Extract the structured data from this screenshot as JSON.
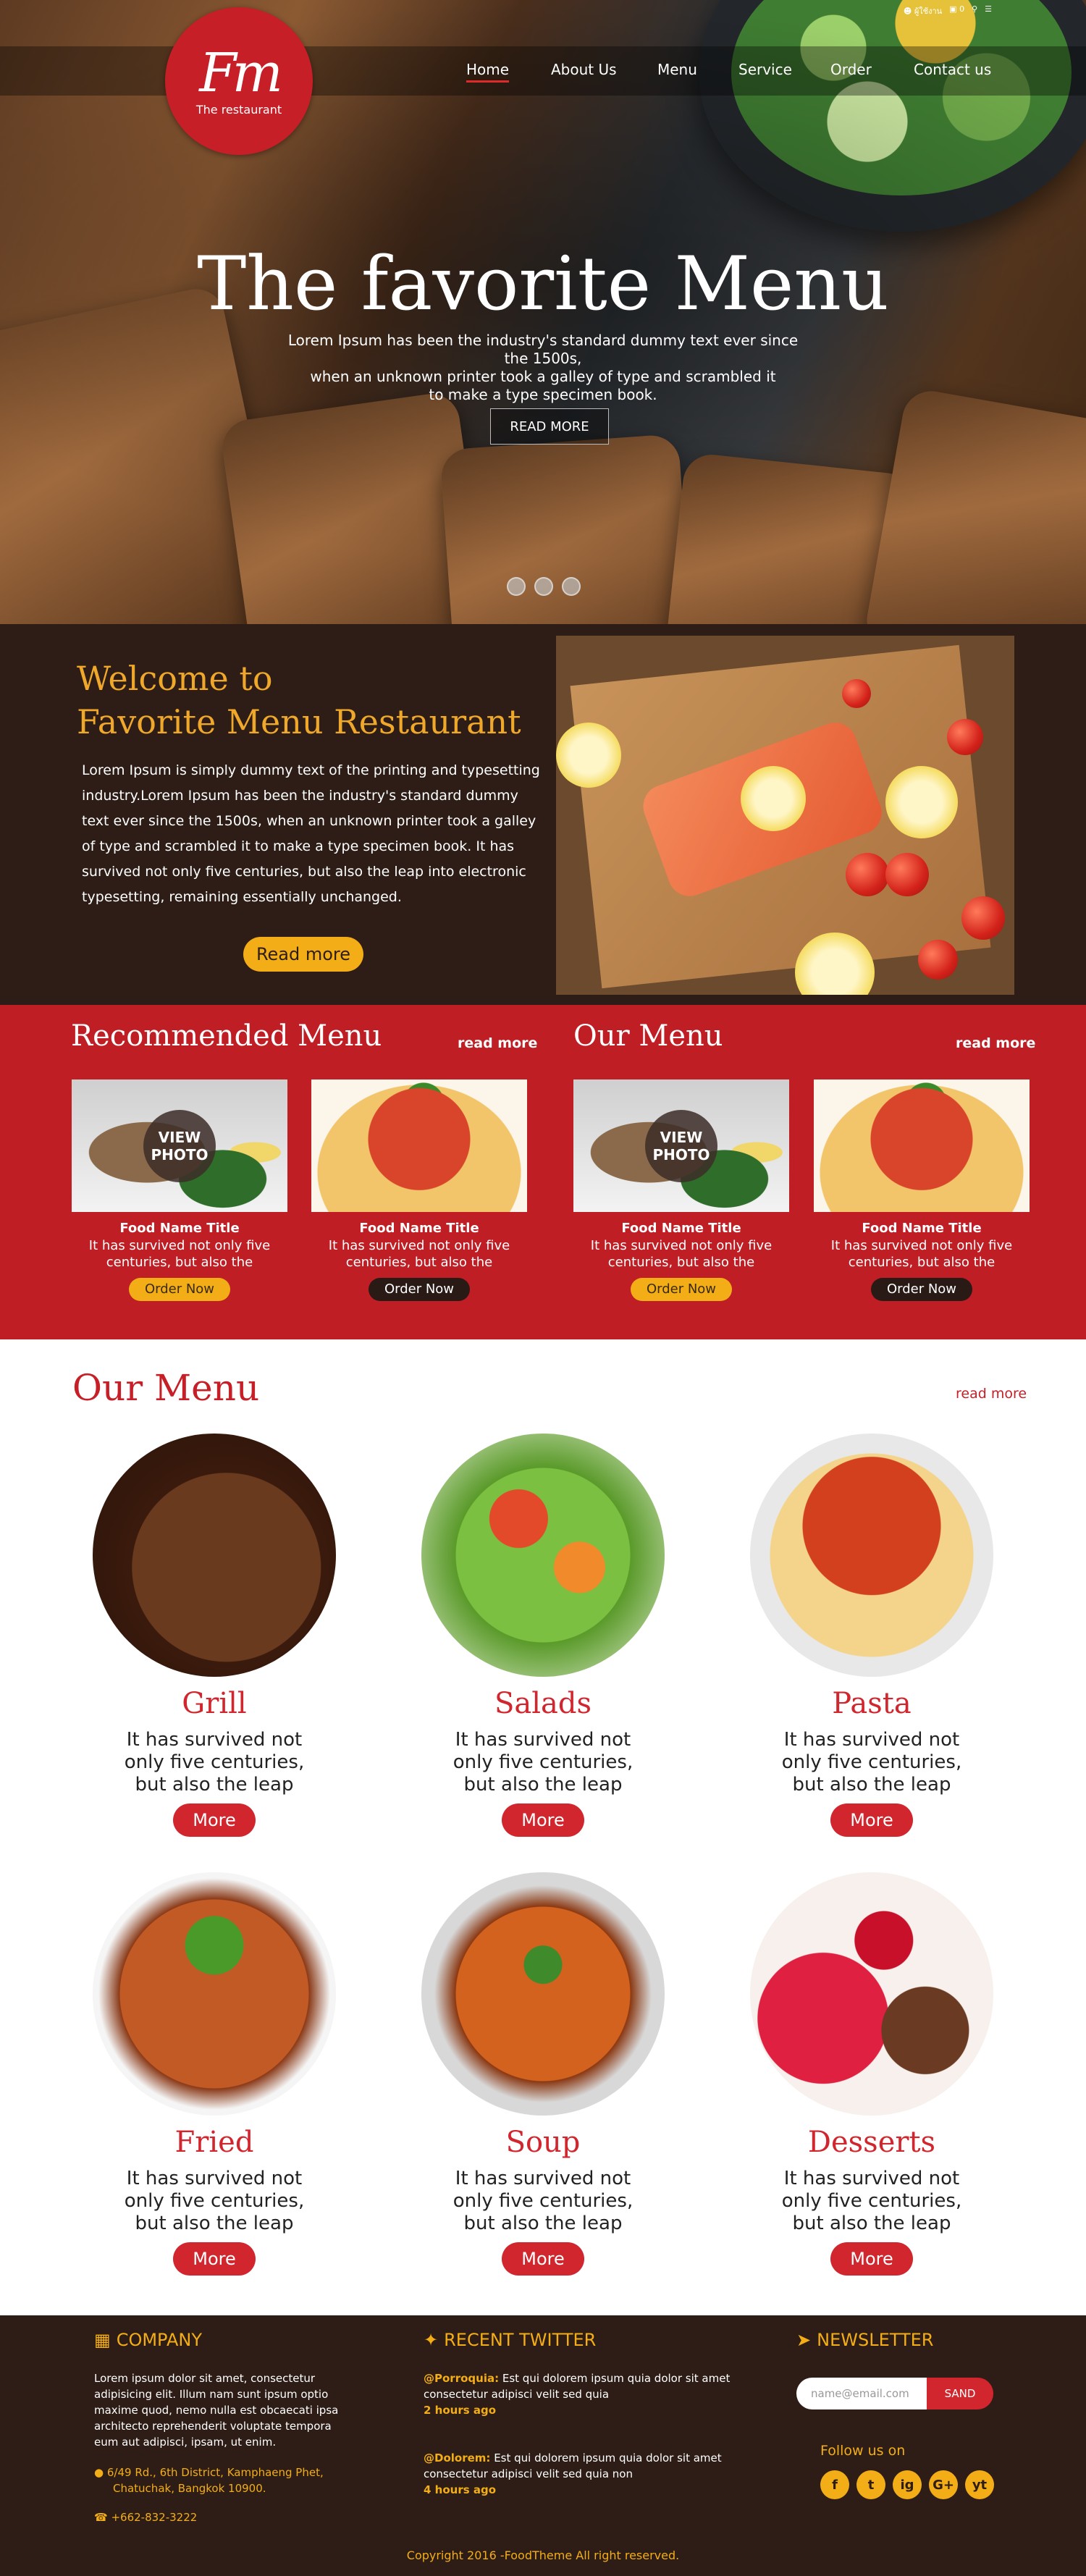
{
  "topbar": {
    "user_label": "ผู้ใช้งาน",
    "cart_count": "0"
  },
  "logo": {
    "mark": "Fm",
    "subtitle": "The restaurant"
  },
  "nav": {
    "items": [
      "Home",
      "About Us",
      "Menu",
      "Service",
      "Order",
      "Contact us"
    ],
    "active": "Home"
  },
  "hero": {
    "title": "The favorite Menu",
    "text_lines": [
      "Lorem Ipsum has been the industry's standard dummy text ever since the 1500s,",
      "when an unknown printer took a galley of type and scrambled it",
      "to make a type specimen book."
    ],
    "button": "READ MORE"
  },
  "welcome": {
    "title_lines": [
      "Welcome to",
      "Favorite Menu Restaurant"
    ],
    "text": "Lorem Ipsum is simply dummy text of the printing and typesetting industry.Lorem Ipsum has been the industry's standard dummy text ever since the 1500s, when an unknown printer took a galley of type and scrambled it to make a type specimen book. It has survived not only five centuries, but also the leap into electronic typesetting, remaining essentially unchanged.",
    "button": "Read more"
  },
  "recommended": {
    "title": "Recommended Menu",
    "more": "read more",
    "cards": [
      {
        "title": "Food Name Title",
        "text_lines": [
          "It has survived not only five",
          "centuries, but also the"
        ],
        "button": "Order Now",
        "overlay": [
          "VIEW",
          "PHOTO"
        ]
      },
      {
        "title": "Food Name Title",
        "text_lines": [
          "It has survived not only five",
          "centuries, but also the"
        ],
        "button": "Order Now"
      }
    ]
  },
  "ourmenu_small": {
    "title": "Our Menu",
    "more": "read more",
    "cards": [
      {
        "title": "Food Name Title",
        "text_lines": [
          "It has survived not only five",
          "centuries, but also the"
        ],
        "button": "Order Now",
        "overlay": [
          "VIEW",
          "PHOTO"
        ]
      },
      {
        "title": "Food Name Title",
        "text_lines": [
          "It has survived not only five",
          "centuries, but also the"
        ],
        "button": "Order Now"
      }
    ]
  },
  "ourmenu": {
    "title": "Our Menu",
    "more": "read more",
    "dishes": [
      {
        "name": "Grill",
        "text": "It has survived not only five centuries, but also the leap",
        "button": "More"
      },
      {
        "name": "Salads",
        "text": "It has survived not only five centuries, but also the leap",
        "button": "More"
      },
      {
        "name": "Pasta",
        "text": "It has survived not only five centuries, but also the leap",
        "button": "More"
      },
      {
        "name": "Fried",
        "text": "It has survived not only five centuries, but also the leap",
        "button": "More"
      },
      {
        "name": "Soup",
        "text": "It has survived not only five centuries, but also the leap",
        "button": "More"
      },
      {
        "name": "Desserts",
        "text": "It has survived not only five centuries, but also the leap",
        "button": "More"
      }
    ]
  },
  "footer": {
    "company": {
      "title": "COMPANY",
      "text": "Lorem ipsum dolor sit amet, consectetur adipisicing elit. Illum nam sunt ipsum optio maxime quod, nemo nulla est obcaecati ipsa architecto reprehenderit voluptate tempora eum aut adipisci, ipsam, ut enim.",
      "address_lines": [
        "6/49 Rd., 6th District, Kamphaeng Phet,",
        "Chatuchak, Bangkok 10900."
      ],
      "phone": "+662-832-3222"
    },
    "twitter": {
      "title": "RECENT TWITTER",
      "tweets": [
        {
          "handle": "@Porroquia:",
          "text": "Est qui dolorem ipsum quia dolor sit amet consectetur adipisci velit sed quia",
          "time": "2 hours ago"
        },
        {
          "handle": "@Dolorem:",
          "text": "Est qui dolorem ipsum quia dolor sit amet consectetur adipisci velit sed quia non",
          "time": "4 hours ago"
        }
      ]
    },
    "newsletter": {
      "title": "NEWSLETTER",
      "placeholder": "name@email.com",
      "button": "SAND",
      "follow": "Follow us on"
    },
    "social": [
      "f",
      "t",
      "ig",
      "G+",
      "yt"
    ],
    "copyright": "Copyright 2016 -FoodTheme All right reserved."
  },
  "colors": {
    "brand_red": "#c61f27",
    "accent_orange": "#f3ad16",
    "dark_brown": "#2d1d16"
  }
}
